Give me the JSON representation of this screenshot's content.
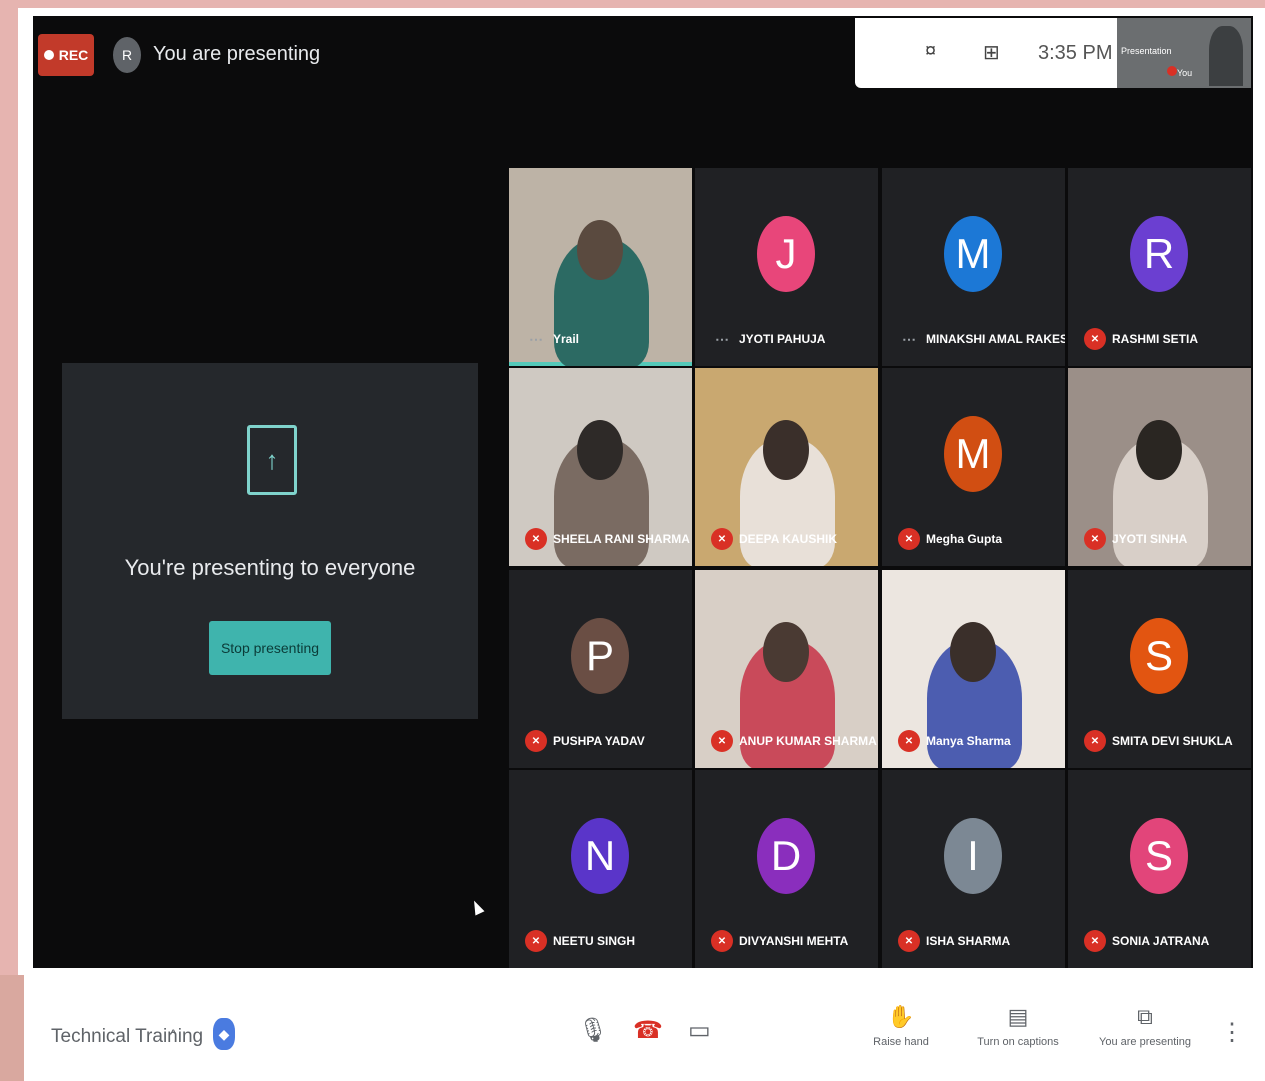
{
  "recording": {
    "label": "REC"
  },
  "presenter_bar": {
    "avatar": "R",
    "text": "You are presenting"
  },
  "system_bar": {
    "icon_a": "¤",
    "icon_b": "⊞",
    "time": "3:35 PM",
    "thumb_title": "Presentation",
    "thumb_sub": "You"
  },
  "presentation": {
    "title": "You're presenting to everyone",
    "stop_button": "Stop presenting"
  },
  "participants": [
    {
      "name": "Yrail",
      "avatar": "",
      "color": "",
      "video": true,
      "muted": false,
      "pinned": true,
      "active": true
    },
    {
      "name": "JYOTI PAHUJA",
      "avatar": "J",
      "color": "#e8467a",
      "video": false,
      "muted": false,
      "pinned": true
    },
    {
      "name": "MINAKSHI AMAL RAKESH",
      "avatar": "M",
      "color": "#1c78d6",
      "video": false,
      "muted": false,
      "pinned": true
    },
    {
      "name": "RASHMI SETIA",
      "avatar": "R",
      "color": "#6b3fd1",
      "video": false,
      "muted": true,
      "pinned": false
    },
    {
      "name": "SHEELA RANI SHARMA",
      "avatar": "",
      "color": "",
      "video": true,
      "muted": true,
      "pinned": false
    },
    {
      "name": "DEEPA KAUSHIK",
      "avatar": "",
      "color": "",
      "video": true,
      "muted": true,
      "pinned": false
    },
    {
      "name": "Megha Gupta",
      "avatar": "M",
      "color": "#d14e12",
      "video": false,
      "muted": true,
      "pinned": false
    },
    {
      "name": "JYOTI SINHA",
      "avatar": "",
      "color": "",
      "video": true,
      "muted": true,
      "pinned": false
    },
    {
      "name": "PUSHPA YADAV",
      "avatar": "P",
      "color": "#6a4e44",
      "video": false,
      "muted": true,
      "pinned": false
    },
    {
      "name": "ANUP KUMAR SHARMA",
      "avatar": "",
      "color": "",
      "video": true,
      "muted": true,
      "pinned": false
    },
    {
      "name": "Manya Sharma",
      "avatar": "",
      "color": "",
      "video": true,
      "muted": true,
      "pinned": false
    },
    {
      "name": "SMITA DEVI SHUKLA",
      "avatar": "S",
      "color": "#e25511",
      "video": false,
      "muted": true,
      "pinned": false
    },
    {
      "name": "NEETU SINGH",
      "avatar": "N",
      "color": "#5a35c9",
      "video": false,
      "muted": true,
      "pinned": false
    },
    {
      "name": "DIVYANSHI MEHTA",
      "avatar": "D",
      "color": "#8a2ebd",
      "video": false,
      "muted": true,
      "pinned": false
    },
    {
      "name": "ISHA SHARMA",
      "avatar": "I",
      "color": "#7c8894",
      "video": false,
      "muted": true,
      "pinned": false
    },
    {
      "name": "SONIA JATRANA",
      "avatar": "S",
      "color": "#e2457a",
      "video": false,
      "muted": true,
      "pinned": false
    }
  ],
  "controls": {
    "meeting_name": "Technical Training",
    "caret": "^",
    "shield_icon": "shield-icon",
    "mic_icon": "mic-icon",
    "end_call_icon": "end-call-icon",
    "camera_icon": "camera-icon",
    "raise_hand": "Raise hand",
    "captions": "Turn on captions",
    "presenting": "You are presenting",
    "more": "⋮"
  }
}
